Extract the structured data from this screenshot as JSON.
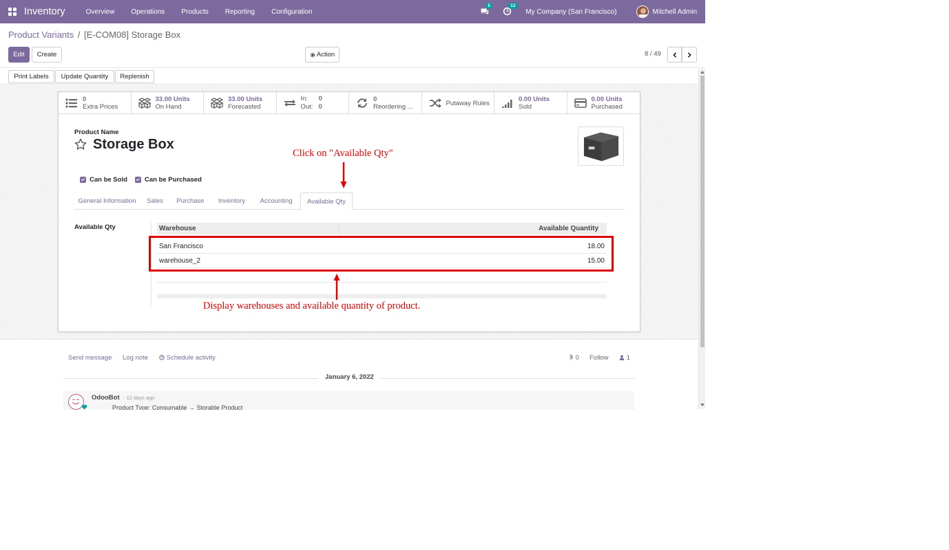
{
  "navbar": {
    "app_name": "Inventory",
    "menu": [
      "Overview",
      "Operations",
      "Products",
      "Reporting",
      "Configuration"
    ],
    "messages_count": "5",
    "activities_count": "13",
    "company": "My Company (San Francisco)",
    "user": "Mitchell Admin"
  },
  "breadcrumb": {
    "parent": "Product Variants",
    "separator": "/",
    "current": "[E-COM08] Storage Box"
  },
  "buttons": {
    "edit": "Edit",
    "create": "Create",
    "action": "Action",
    "pager": "8 / 49"
  },
  "status_buttons": [
    "Print Labels",
    "Update Quantity",
    "Replenish"
  ],
  "smart_buttons": [
    {
      "value": "0",
      "label": "Extra Prices",
      "icon": "list-icon"
    },
    {
      "value": "33.00 Units",
      "label": "On Hand",
      "icon": "cubes-icon"
    },
    {
      "value": "33.00 Units",
      "label": "Forecasted",
      "icon": "cubes-icon"
    },
    {
      "in_label": "In:",
      "in_value": "0",
      "out_label": "Out:",
      "out_value": "0",
      "icon": "exchange-icon"
    },
    {
      "value": "0",
      "label": "Reordering ...",
      "icon": "refresh-icon"
    },
    {
      "value": "",
      "label": "Putaway Rules",
      "icon": "random-icon"
    },
    {
      "value": "0.00 Units",
      "label": "Sold",
      "icon": "signal-icon"
    },
    {
      "value": "0.00 Units",
      "label": "Purchased",
      "icon": "credit-card-icon"
    }
  ],
  "product": {
    "name_label": "Product Name",
    "name": "Storage Box",
    "can_be_sold": "Can be Sold",
    "can_be_purchased": "Can be Purchased"
  },
  "tabs": [
    "General Information",
    "Sales",
    "Purchase",
    "Inventory",
    "Accounting",
    "Available Qty"
  ],
  "available_qty": {
    "label": "Available Qty",
    "headers": {
      "warehouse": "Warehouse",
      "quantity": "Available Quantity"
    },
    "rows": [
      {
        "warehouse": "San Francisco",
        "quantity": "18.00"
      },
      {
        "warehouse": "warehouse_2",
        "quantity": "15.00"
      }
    ]
  },
  "annotations": {
    "top": "Click on \"Available Qty\"",
    "bottom": "Display warehouses and available quantity of product.",
    "color": "#e00000"
  },
  "chatter": {
    "send_message": "Send message",
    "log_note": "Log note",
    "schedule_activity": "Schedule activity",
    "attachments": "0",
    "follow": "Follow",
    "followers": "1",
    "date": "January 6, 2022",
    "author": "OdooBot",
    "when": "- 12 days ago",
    "message_partial": "Product Type: Consumable → Storable Product"
  },
  "colors": {
    "brand": "#7c6a9e",
    "badge": "#00a09d"
  }
}
